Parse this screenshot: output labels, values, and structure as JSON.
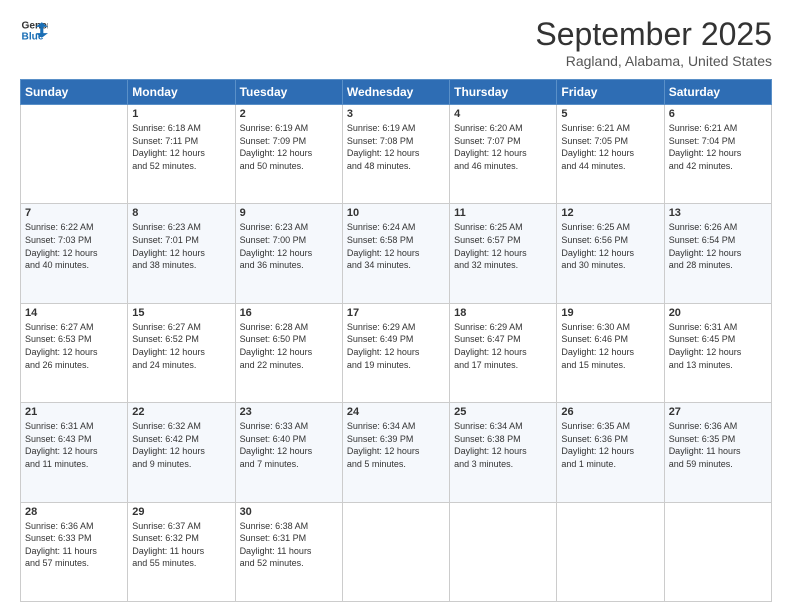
{
  "logo": {
    "line1": "General",
    "line2": "Blue"
  },
  "title": "September 2025",
  "location": "Ragland, Alabama, United States",
  "days_of_week": [
    "Sunday",
    "Monday",
    "Tuesday",
    "Wednesday",
    "Thursday",
    "Friday",
    "Saturday"
  ],
  "weeks": [
    [
      {
        "day": "",
        "info": ""
      },
      {
        "day": "1",
        "info": "Sunrise: 6:18 AM\nSunset: 7:11 PM\nDaylight: 12 hours\nand 52 minutes."
      },
      {
        "day": "2",
        "info": "Sunrise: 6:19 AM\nSunset: 7:09 PM\nDaylight: 12 hours\nand 50 minutes."
      },
      {
        "day": "3",
        "info": "Sunrise: 6:19 AM\nSunset: 7:08 PM\nDaylight: 12 hours\nand 48 minutes."
      },
      {
        "day": "4",
        "info": "Sunrise: 6:20 AM\nSunset: 7:07 PM\nDaylight: 12 hours\nand 46 minutes."
      },
      {
        "day": "5",
        "info": "Sunrise: 6:21 AM\nSunset: 7:05 PM\nDaylight: 12 hours\nand 44 minutes."
      },
      {
        "day": "6",
        "info": "Sunrise: 6:21 AM\nSunset: 7:04 PM\nDaylight: 12 hours\nand 42 minutes."
      }
    ],
    [
      {
        "day": "7",
        "info": "Sunrise: 6:22 AM\nSunset: 7:03 PM\nDaylight: 12 hours\nand 40 minutes."
      },
      {
        "day": "8",
        "info": "Sunrise: 6:23 AM\nSunset: 7:01 PM\nDaylight: 12 hours\nand 38 minutes."
      },
      {
        "day": "9",
        "info": "Sunrise: 6:23 AM\nSunset: 7:00 PM\nDaylight: 12 hours\nand 36 minutes."
      },
      {
        "day": "10",
        "info": "Sunrise: 6:24 AM\nSunset: 6:58 PM\nDaylight: 12 hours\nand 34 minutes."
      },
      {
        "day": "11",
        "info": "Sunrise: 6:25 AM\nSunset: 6:57 PM\nDaylight: 12 hours\nand 32 minutes."
      },
      {
        "day": "12",
        "info": "Sunrise: 6:25 AM\nSunset: 6:56 PM\nDaylight: 12 hours\nand 30 minutes."
      },
      {
        "day": "13",
        "info": "Sunrise: 6:26 AM\nSunset: 6:54 PM\nDaylight: 12 hours\nand 28 minutes."
      }
    ],
    [
      {
        "day": "14",
        "info": "Sunrise: 6:27 AM\nSunset: 6:53 PM\nDaylight: 12 hours\nand 26 minutes."
      },
      {
        "day": "15",
        "info": "Sunrise: 6:27 AM\nSunset: 6:52 PM\nDaylight: 12 hours\nand 24 minutes."
      },
      {
        "day": "16",
        "info": "Sunrise: 6:28 AM\nSunset: 6:50 PM\nDaylight: 12 hours\nand 22 minutes."
      },
      {
        "day": "17",
        "info": "Sunrise: 6:29 AM\nSunset: 6:49 PM\nDaylight: 12 hours\nand 19 minutes."
      },
      {
        "day": "18",
        "info": "Sunrise: 6:29 AM\nSunset: 6:47 PM\nDaylight: 12 hours\nand 17 minutes."
      },
      {
        "day": "19",
        "info": "Sunrise: 6:30 AM\nSunset: 6:46 PM\nDaylight: 12 hours\nand 15 minutes."
      },
      {
        "day": "20",
        "info": "Sunrise: 6:31 AM\nSunset: 6:45 PM\nDaylight: 12 hours\nand 13 minutes."
      }
    ],
    [
      {
        "day": "21",
        "info": "Sunrise: 6:31 AM\nSunset: 6:43 PM\nDaylight: 12 hours\nand 11 minutes."
      },
      {
        "day": "22",
        "info": "Sunrise: 6:32 AM\nSunset: 6:42 PM\nDaylight: 12 hours\nand 9 minutes."
      },
      {
        "day": "23",
        "info": "Sunrise: 6:33 AM\nSunset: 6:40 PM\nDaylight: 12 hours\nand 7 minutes."
      },
      {
        "day": "24",
        "info": "Sunrise: 6:34 AM\nSunset: 6:39 PM\nDaylight: 12 hours\nand 5 minutes."
      },
      {
        "day": "25",
        "info": "Sunrise: 6:34 AM\nSunset: 6:38 PM\nDaylight: 12 hours\nand 3 minutes."
      },
      {
        "day": "26",
        "info": "Sunrise: 6:35 AM\nSunset: 6:36 PM\nDaylight: 12 hours\nand 1 minute."
      },
      {
        "day": "27",
        "info": "Sunrise: 6:36 AM\nSunset: 6:35 PM\nDaylight: 11 hours\nand 59 minutes."
      }
    ],
    [
      {
        "day": "28",
        "info": "Sunrise: 6:36 AM\nSunset: 6:33 PM\nDaylight: 11 hours\nand 57 minutes."
      },
      {
        "day": "29",
        "info": "Sunrise: 6:37 AM\nSunset: 6:32 PM\nDaylight: 11 hours\nand 55 minutes."
      },
      {
        "day": "30",
        "info": "Sunrise: 6:38 AM\nSunset: 6:31 PM\nDaylight: 11 hours\nand 52 minutes."
      },
      {
        "day": "",
        "info": ""
      },
      {
        "day": "",
        "info": ""
      },
      {
        "day": "",
        "info": ""
      },
      {
        "day": "",
        "info": ""
      }
    ]
  ]
}
